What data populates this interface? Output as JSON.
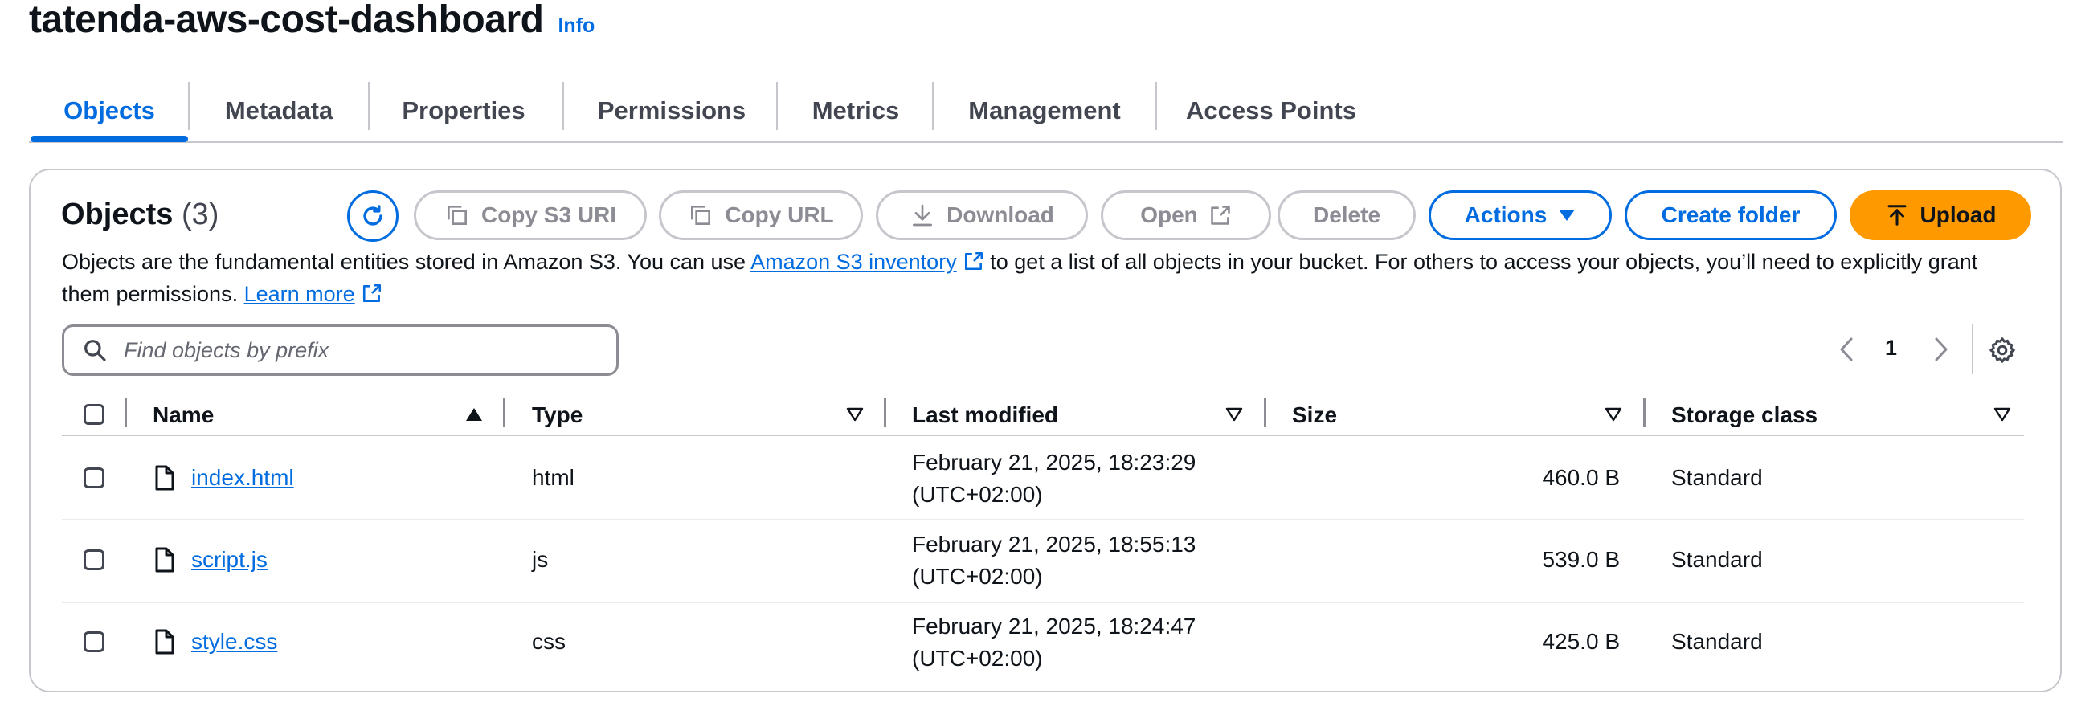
{
  "bucket": {
    "title": "tatenda-aws-cost-dashboard",
    "info_label": "Info"
  },
  "tabs": [
    {
      "label": "Objects",
      "active": true
    },
    {
      "label": "Metadata"
    },
    {
      "label": "Properties"
    },
    {
      "label": "Permissions"
    },
    {
      "label": "Metrics"
    },
    {
      "label": "Management"
    },
    {
      "label": "Access Points"
    }
  ],
  "objects_panel": {
    "heading": "Objects",
    "count": "(3)",
    "description_part1": "Objects are the fundamental entities stored in Amazon S3. You can use ",
    "inventory_link": "Amazon S3 inventory",
    "description_part2": " to get a list of all objects in your bucket. For others to access your objects, you’ll need to explicitly grant them permissions. ",
    "learn_more": "Learn more"
  },
  "toolbar": {
    "copy_s3_uri": "Copy S3 URI",
    "copy_url": "Copy URL",
    "download": "Download",
    "open": "Open",
    "delete": "Delete",
    "actions": "Actions",
    "create_folder": "Create folder",
    "upload": "Upload"
  },
  "search": {
    "placeholder": "Find objects by prefix"
  },
  "pagination": {
    "current_page": "1"
  },
  "table": {
    "columns": [
      "Name",
      "Type",
      "Last modified",
      "Size",
      "Storage class"
    ],
    "rows": [
      {
        "name": "index.html",
        "type": "html",
        "modified_date": "February 21, 2025, 18:23:29",
        "modified_tz": "(UTC+02:00)",
        "size": "460.0 B",
        "storage": "Standard"
      },
      {
        "name": "script.js",
        "type": "js",
        "modified_date": "February 21, 2025, 18:55:13",
        "modified_tz": "(UTC+02:00)",
        "size": "539.0 B",
        "storage": "Standard"
      },
      {
        "name": "style.css",
        "type": "css",
        "modified_date": "February 21, 2025, 18:24:47",
        "modified_tz": "(UTC+02:00)",
        "size": "425.0 B",
        "storage": "Standard"
      }
    ]
  },
  "colors": {
    "accent": "#006ce0",
    "upload": "#ff9900",
    "border": "#c6c6cd",
    "disabled": "#8c8c94"
  }
}
